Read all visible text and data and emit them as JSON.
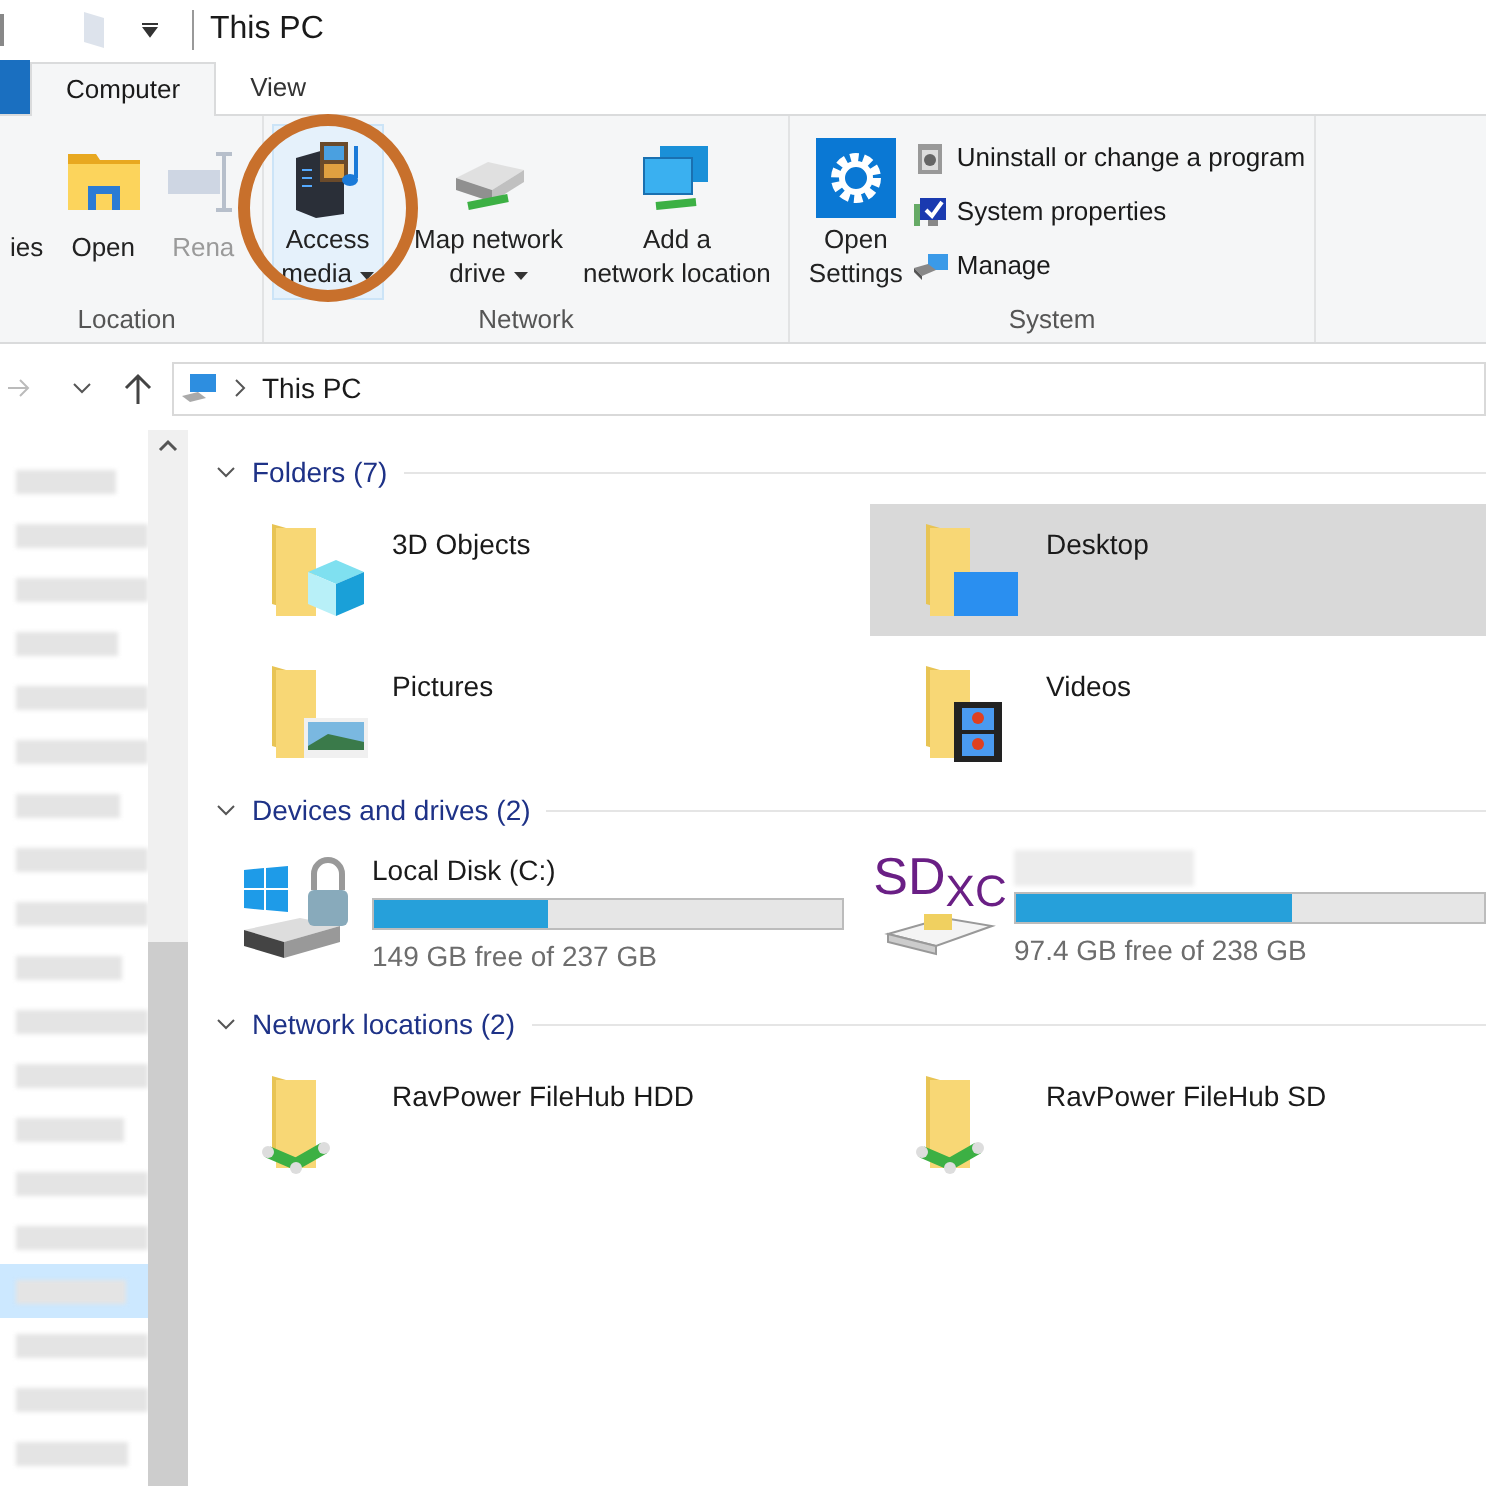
{
  "window": {
    "title": "This PC"
  },
  "tabs": [
    {
      "label": "Computer",
      "selected": true
    },
    {
      "label": "View",
      "selected": false
    }
  ],
  "ribbon": {
    "groups": [
      {
        "label": "Location",
        "items": [
          {
            "kind": "large",
            "label": "ies",
            "disabled": false
          },
          {
            "kind": "large",
            "label": "Open",
            "disabled": false
          },
          {
            "kind": "large",
            "label": "Rena",
            "disabled": true
          }
        ]
      },
      {
        "label": "Network",
        "items": [
          {
            "kind": "large",
            "label": "Access media",
            "selected": true
          },
          {
            "kind": "large",
            "label": "Map network drive",
            "selected": false
          },
          {
            "kind": "large",
            "label": "Add a network location",
            "selected": false
          }
        ]
      },
      {
        "label": "System",
        "items": [
          {
            "kind": "large",
            "label": "Open Settings"
          },
          {
            "kind": "small",
            "label": "Uninstall or change a program"
          },
          {
            "kind": "small",
            "label": "System properties"
          },
          {
            "kind": "small",
            "label": "Manage"
          }
        ]
      }
    ]
  },
  "address": {
    "path": "This PC"
  },
  "sidebar": {
    "items": [
      {
        "selected": false
      },
      {
        "selected": false
      },
      {
        "selected": false
      },
      {
        "selected": false
      },
      {
        "selected": false
      },
      {
        "selected": false
      },
      {
        "selected": false
      },
      {
        "selected": false
      },
      {
        "selected": false
      },
      {
        "selected": false
      },
      {
        "selected": false
      },
      {
        "selected": false
      },
      {
        "selected": false
      },
      {
        "selected": false
      },
      {
        "selected": false
      },
      {
        "selected": true
      },
      {
        "selected": false
      },
      {
        "selected": false
      },
      {
        "selected": false
      }
    ]
  },
  "sections": [
    {
      "kind": "folders",
      "title": "Folders (7)",
      "items": [
        {
          "name": "3D Objects",
          "selected": false
        },
        {
          "name": "Desktop",
          "selected": true
        },
        {
          "name": "Pictures",
          "selected": false
        },
        {
          "name": "Videos",
          "selected": false
        }
      ]
    },
    {
      "kind": "drives",
      "title": "Devices and drives (2)",
      "items": [
        {
          "name": "Local Disk (C:)",
          "level": 0.37,
          "free": "149 GB free of 237 GB"
        },
        {
          "badge": "SD",
          "badge_sub": "XC",
          "level": 0.59,
          "free": "97.4 GB free of 238 GB"
        }
      ]
    },
    {
      "kind": "network",
      "title": "Network locations (2)",
      "items": [
        {
          "name": "RavPower FileHub HDD"
        },
        {
          "name": "RavPower FileHub SD"
        }
      ]
    }
  ]
}
